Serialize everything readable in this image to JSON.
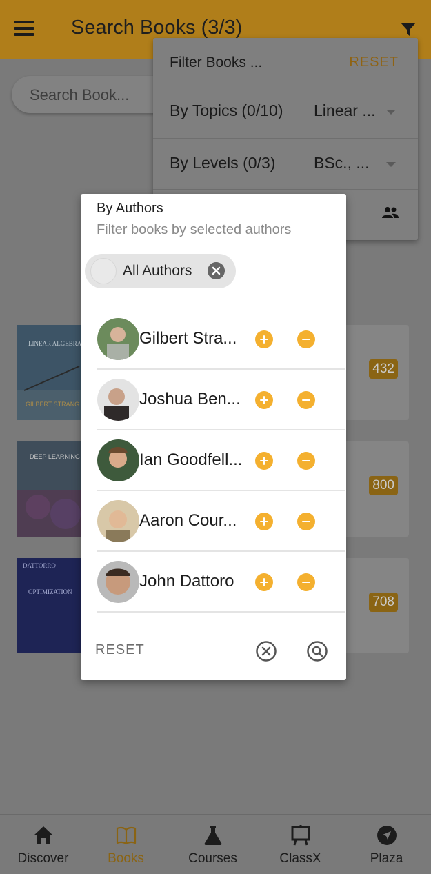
{
  "app_bar": {
    "title": "Search Books (3/3)"
  },
  "search": {
    "placeholder": "Search Book..."
  },
  "books": [
    {
      "cover_title": "LINEAR ALGEBRA and Learning from Data",
      "cover_author": "GILBERT STRANG",
      "count": "432"
    },
    {
      "cover_title": "DEEP LEARNING",
      "count": "800"
    },
    {
      "cover_title": "CONVEX OPTIMIZATION EUCLIDEAN DISTANCE GEOMETRY",
      "cover_author": "DATTORRO",
      "count": "708"
    }
  ],
  "filter_panel": {
    "title": "Filter Books ...",
    "reset_label": "RESET",
    "rows": [
      {
        "label": "By Topics (0/10)",
        "value": "Linear ..."
      },
      {
        "label": "By Levels (0/3)",
        "value": "BSc., ..."
      }
    ]
  },
  "authors_dialog": {
    "title": "By Authors",
    "subtitle": "Filter books by selected authors",
    "chip_label": "All Authors",
    "authors": [
      {
        "name": "Gilbert Stra..."
      },
      {
        "name": "Joshua Ben..."
      },
      {
        "name": "Ian Goodfell..."
      },
      {
        "name": "Aaron Cour..."
      },
      {
        "name": "John Dattoro"
      }
    ],
    "reset_label": "RESET"
  },
  "bottom_nav": {
    "items": [
      {
        "label": "Discover",
        "icon": "home-icon"
      },
      {
        "label": "Books",
        "icon": "book-icon"
      },
      {
        "label": "Courses",
        "icon": "flask-icon"
      },
      {
        "label": "ClassX",
        "icon": "easel-icon"
      },
      {
        "label": "Plaza",
        "icon": "navigation-icon"
      }
    ],
    "active": "Books"
  },
  "colors": {
    "accent": "#f4b02f",
    "appbar": "#b07e1a",
    "active_nav": "#8a6414"
  }
}
